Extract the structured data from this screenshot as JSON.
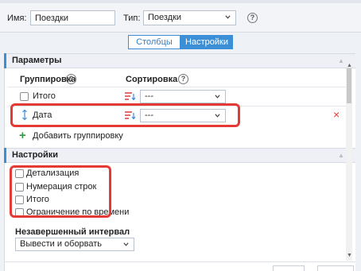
{
  "filter": {
    "name_label": "Имя:",
    "name_value": "Поездки",
    "type_label": "Тип:",
    "type_value": "Поездки",
    "help": "?"
  },
  "tabs": [
    {
      "label": "Столбцы",
      "active": false
    },
    {
      "label": "Настройки",
      "active": true
    }
  ],
  "params": {
    "title": "Параметры",
    "grouping_header": "Группировка",
    "sorting_header": "Сортировка",
    "rows": [
      {
        "label": "Итого",
        "sort": "---"
      },
      {
        "label": "Дата",
        "sort": "---",
        "removable": true
      }
    ],
    "add_grouping": "Добавить группировку",
    "remove_symbol": "×"
  },
  "settings": {
    "title": "Настройки",
    "options": [
      {
        "label": "Детализация",
        "checked": false
      },
      {
        "label": "Нумерация строк",
        "checked": false
      },
      {
        "label": "Итого",
        "checked": false
      },
      {
        "label": "Ограничение по времени",
        "checked": false
      }
    ],
    "interval_label": "Незавершенный интервал",
    "interval_value": "Вывести и оборвать"
  },
  "colors": {
    "accent": "#3c8fd6",
    "highlight": "#e53935",
    "add": "#2e9b3f"
  }
}
